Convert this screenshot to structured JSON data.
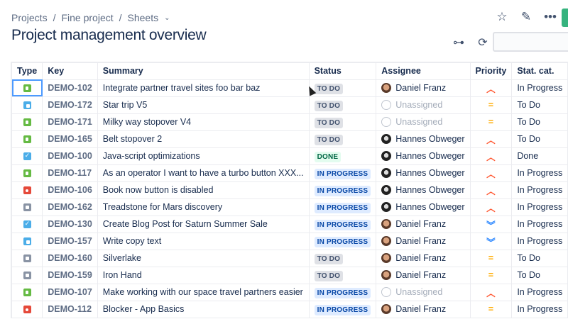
{
  "breadcrumb": [
    "Projects",
    "Fine project",
    "Sheets"
  ],
  "title": "Project management overview",
  "icons": {
    "star": "star-icon",
    "edit": "pencil-icon",
    "more": "more-icon",
    "hierarchy": "hierarchy-icon",
    "refresh": "refresh-icon"
  },
  "columns": [
    "Type",
    "Key",
    "Summary",
    "Status",
    "Assignee",
    "Priority",
    "Stat. cat."
  ],
  "rows": [
    {
      "type": "story",
      "key": "DEMO-102",
      "summary": "Integrate partner travel sites foo bar baz",
      "status": "TO DO",
      "assignee": "Daniel Franz",
      "priority": "high",
      "cat": "In Progress"
    },
    {
      "type": "subtask",
      "key": "DEMO-172",
      "summary": "Star trip V5",
      "status": "TO DO",
      "assignee": "Unassigned",
      "priority": "medium",
      "cat": "To Do"
    },
    {
      "type": "story",
      "key": "DEMO-171",
      "summary": "Milky way stopover V4",
      "status": "TO DO",
      "assignee": "Unassigned",
      "priority": "medium",
      "cat": "To Do"
    },
    {
      "type": "story",
      "key": "DEMO-165",
      "summary": "Belt stopover 2",
      "status": "TO DO",
      "assignee": "Hannes Obweger",
      "priority": "high",
      "cat": "To Do"
    },
    {
      "type": "task",
      "key": "DEMO-100",
      "summary": "Java-script optimizations",
      "status": "DONE",
      "assignee": "Hannes Obweger",
      "priority": "high",
      "cat": "Done"
    },
    {
      "type": "story",
      "key": "DEMO-117",
      "summary": "As an operator I want to have a turbo button XXX...",
      "status": "IN PROGRESS",
      "assignee": "Hannes Obweger",
      "priority": "high",
      "cat": "In Progress"
    },
    {
      "type": "bug",
      "key": "DEMO-106",
      "summary": "Book now button is disabled",
      "status": "IN PROGRESS",
      "assignee": "Hannes Obweger",
      "priority": "high",
      "cat": "In Progress"
    },
    {
      "type": "epic",
      "key": "DEMO-162",
      "summary": "Treadstone for Mars discovery",
      "status": "IN PROGRESS",
      "assignee": "Hannes Obweger",
      "priority": "high",
      "cat": "In Progress"
    },
    {
      "type": "task",
      "key": "DEMO-130",
      "summary": "Create Blog Post for Saturn Summer Sale",
      "status": "IN PROGRESS",
      "assignee": "Daniel Franz",
      "priority": "low",
      "cat": "In Progress"
    },
    {
      "type": "subtask",
      "key": "DEMO-157",
      "summary": "Write copy text",
      "status": "IN PROGRESS",
      "assignee": "Daniel Franz",
      "priority": "low",
      "cat": "In Progress"
    },
    {
      "type": "epic",
      "key": "DEMO-160",
      "summary": "Silverlake",
      "status": "TO DO",
      "assignee": "Daniel Franz",
      "priority": "medium",
      "cat": "To Do"
    },
    {
      "type": "epic",
      "key": "DEMO-159",
      "summary": "Iron Hand",
      "status": "TO DO",
      "assignee": "Daniel Franz",
      "priority": "medium",
      "cat": "To Do"
    },
    {
      "type": "story",
      "key": "DEMO-107",
      "summary": "Make working with our space travel partners easier",
      "status": "IN PROGRESS",
      "assignee": "Unassigned",
      "priority": "high",
      "cat": "In Progress"
    },
    {
      "type": "bug",
      "key": "DEMO-112",
      "summary": "Blocker - App Basics",
      "status": "IN PROGRESS",
      "assignee": "Daniel Franz",
      "priority": "medium",
      "cat": "In Progress"
    }
  ]
}
